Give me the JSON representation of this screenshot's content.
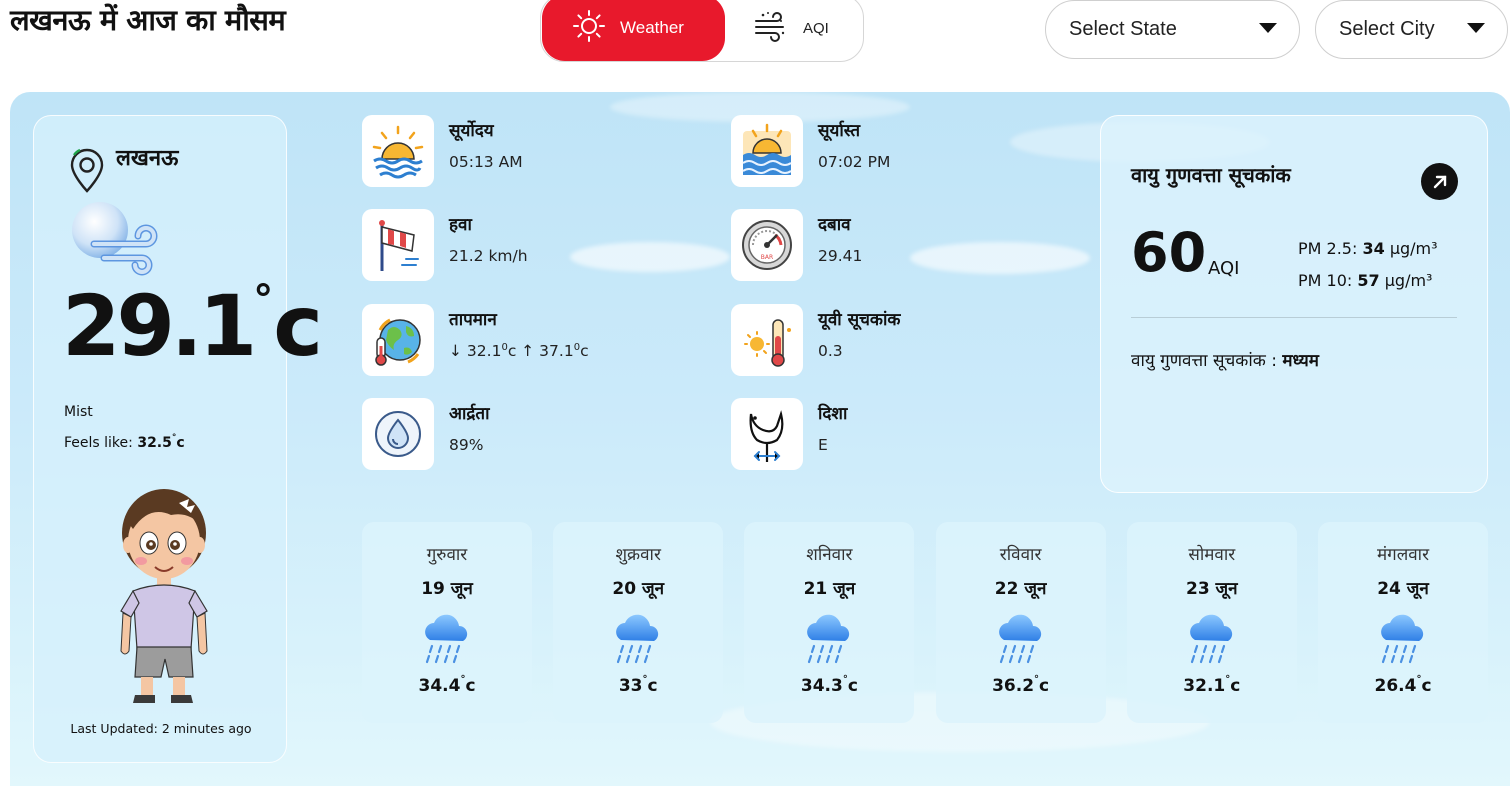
{
  "header": {
    "title": "लखनऊ में आज का मौसम",
    "tabs": {
      "weather": "Weather",
      "aqi": "AQI"
    },
    "selects": {
      "state": "Select State",
      "city": "Select City"
    }
  },
  "current": {
    "city": "लखनऊ",
    "temp": "29.1",
    "temp_unit": "c",
    "deg": "°",
    "condition": "Mist",
    "feels_label": "Feels like: ",
    "feels_value": "32.5",
    "feels_unit": "c",
    "updated": "Last Updated: 2 minutes ago"
  },
  "metrics": {
    "sunrise": {
      "label": "सूर्योदय",
      "value": "05:13 AM"
    },
    "sunset": {
      "label": "सूर्यास्त",
      "value": "07:02 PM"
    },
    "wind": {
      "label": "हवा",
      "value": "21.2 km/h"
    },
    "pressure": {
      "label": "दबाव",
      "value": "29.41"
    },
    "temperature": {
      "label": "तापमान",
      "min": "↓ 32.1",
      "max": " ↑ 37.1",
      "unit": "c",
      "deg": "0"
    },
    "uv": {
      "label": "यूवी सूचकांक",
      "value": "0.3"
    },
    "humidity": {
      "label": "आर्द्रता",
      "value": "89%"
    },
    "direction": {
      "label": "दिशा",
      "value": "E"
    }
  },
  "aqi": {
    "title": "वायु गुणवत्ता सूचकांक",
    "value": "60",
    "unit": "AQI",
    "pm25_label": "PM 2.5: ",
    "pm25_value": "34",
    "pm25_unit": " µg/m³",
    "pm10_label": "PM 10: ",
    "pm10_value": "57",
    "pm10_unit": " µg/m³",
    "status_label": "वायु गुणवत्ता सूचकांक : ",
    "status_value": "मध्यम"
  },
  "forecast": [
    {
      "day": "गुरुवार",
      "date": "19 जून",
      "temp": "34.4",
      "unit": "c"
    },
    {
      "day": "शुक्रवार",
      "date": "20 जून",
      "temp": "33",
      "unit": "c"
    },
    {
      "day": "शनिवार",
      "date": "21 जून",
      "temp": "34.3",
      "unit": "c"
    },
    {
      "day": "रविवार",
      "date": "22 जून",
      "temp": "36.2",
      "unit": "c"
    },
    {
      "day": "सोमवार",
      "date": "23 जून",
      "temp": "32.1",
      "unit": "c"
    },
    {
      "day": "मंगलवार",
      "date": "24 जून",
      "temp": "26.4",
      "unit": "c"
    }
  ],
  "icons": {
    "sun": "sun-icon",
    "wind": "wind-lines-icon",
    "pin": "location-pin-icon",
    "cloud": "cloud-wind-icon",
    "rain": "rain-cloud-icon",
    "arrow": "arrow-up-right-icon"
  },
  "colors": {
    "accent": "#e8192c",
    "panel": "#c9eaf9",
    "card": "#ffffff"
  }
}
